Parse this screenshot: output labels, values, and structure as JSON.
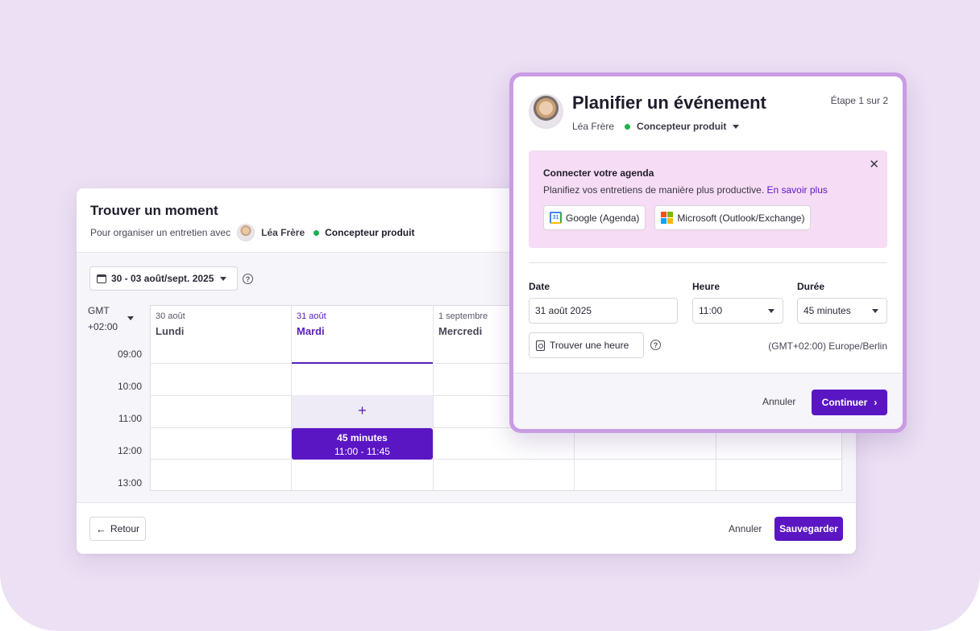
{
  "background_card": {
    "title": "Trouver un moment",
    "subtitle_prefix": "Pour organiser un entretien avec",
    "person_name": "Léa Frère",
    "role": "Concepteur produit",
    "date_range": "30 - 03 août/sept. 2025",
    "timezone_line1": "GMT",
    "timezone_line2": "+02:00",
    "days": [
      {
        "date": "30 août",
        "name": "Lundi"
      },
      {
        "date": "31 août",
        "name": "Mardi"
      },
      {
        "date": "1 septembre",
        "name": "Mercredi"
      }
    ],
    "hours": [
      "09:00",
      "10:00",
      "11:00",
      "12:00",
      "13:00"
    ],
    "slot_plus": "+",
    "event": {
      "title": "45 minutes",
      "time": "11:00 - 11:45"
    },
    "back_label": "Retour",
    "cancel_label": "Annuler",
    "save_label": "Sauvegarder"
  },
  "modal": {
    "title": "Planifier un événement",
    "step": "Étape 1 sur 2",
    "person_name": "Léa Frère",
    "role": "Concepteur produit",
    "banner": {
      "title": "Connecter votre agenda",
      "text": "Planifiez vos entretiens de manière plus productive.",
      "link": "En savoir plus",
      "close": "✕",
      "google_label": "Google (Agenda)",
      "google_icon_text": "31",
      "microsoft_label": "Microsoft (Outlook/Exchange)"
    },
    "date_label": "Date",
    "date_value": "31 août 2025",
    "time_label": "Heure",
    "time_value": "11:00",
    "duration_label": "Durée",
    "duration_value": "45 minutes",
    "find_time_label": "Trouver une heure",
    "timezone": "(GMT+02:00) Europe/Berlin",
    "cancel_label": "Annuler",
    "continue_label": "Continuer",
    "continue_icon": "›"
  },
  "colors": {
    "page_bg": "#ece0f4",
    "accent": "#5b16c4",
    "banner_bg": "#f6dcf4",
    "status_dot": "#1bb24b",
    "modal_border": "#c99ce3"
  }
}
